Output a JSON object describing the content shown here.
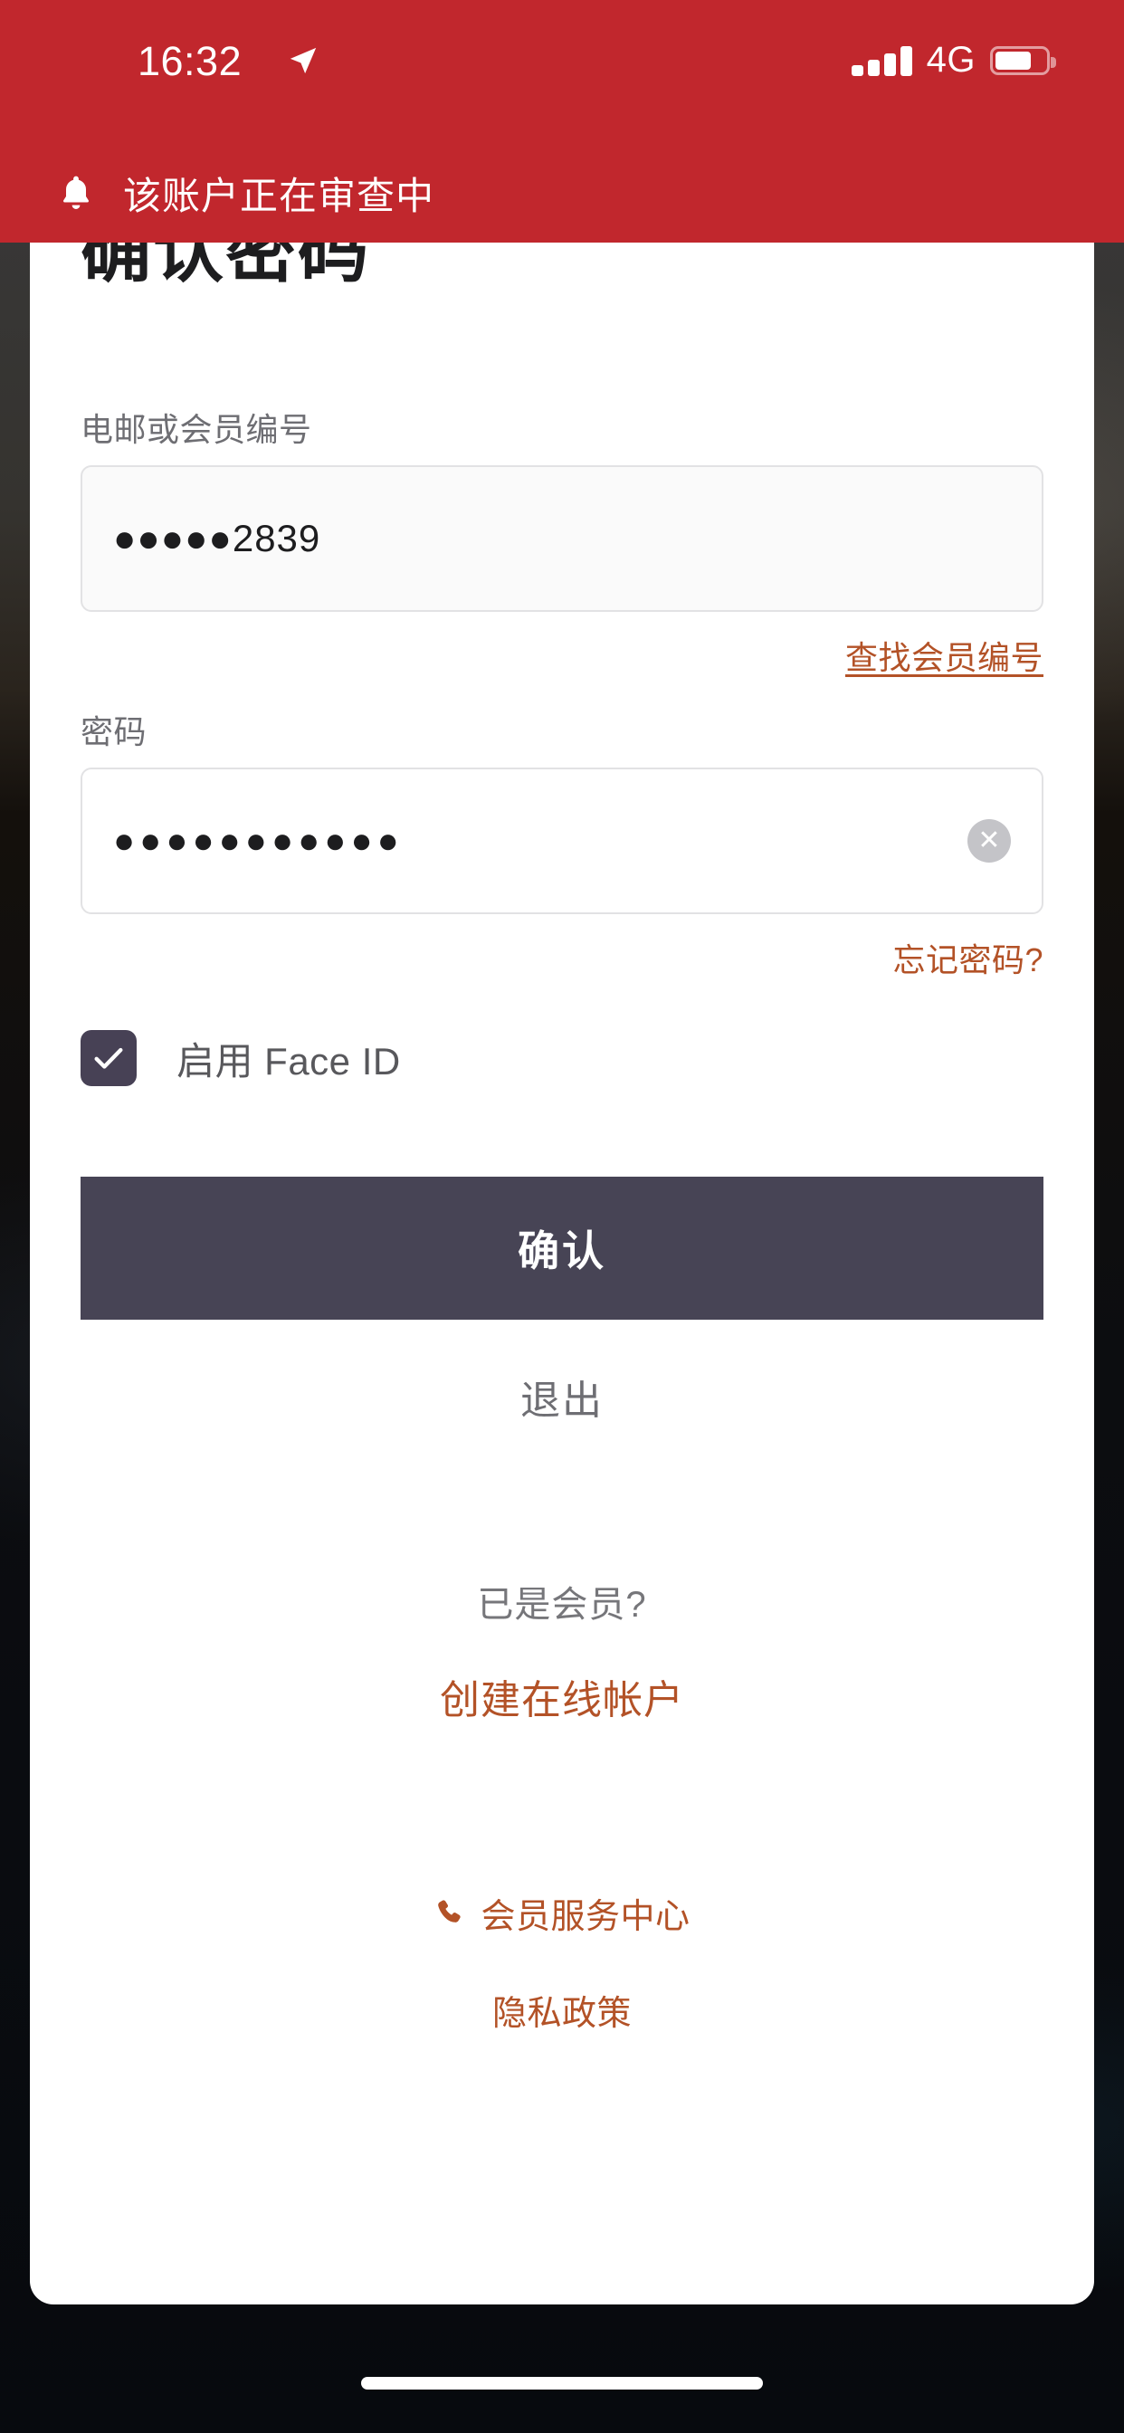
{
  "status_bar": {
    "time": "16:32",
    "location_icon": "location-arrow-icon",
    "signal_icon": "signal-bars-icon",
    "network": "4G",
    "battery_icon": "battery-icon",
    "battery_level_percent": 72,
    "background_color": "#c1272d",
    "text_color": "#ffffff"
  },
  "banner": {
    "icon": "bell-icon",
    "message": "该账户正在审查中",
    "background_color": "#c1272d",
    "text_color": "#ffffff"
  },
  "card": {
    "title": "确认密码",
    "member_field": {
      "label": "电邮或会员编号",
      "value": "●●●●●2839",
      "placeholder": "电邮或会员编号",
      "helper_link": "查找会员编号"
    },
    "password_field": {
      "label": "密码",
      "value": "●●●●●●●●●●●",
      "placeholder": "密码",
      "clear_icon": "close-circle-icon",
      "helper_link": "忘记密码?"
    },
    "face_id": {
      "label": "启用 Face ID",
      "checked": true,
      "check_icon": "checkmark-icon",
      "box_color": "#474155"
    },
    "confirm_button": {
      "label": "确认",
      "background_color": "#474455",
      "text_color": "#ffffff"
    },
    "logout_button": {
      "label": "退出",
      "text_color": "#6e6e73"
    },
    "signup": {
      "prompt": "已是会员?",
      "link": "创建在线帐户"
    },
    "footer": {
      "phone_icon": "phone-icon",
      "service_link": "会员服务中心",
      "privacy_link": "隐私政策"
    },
    "accent_color": "#b35227",
    "background_color": "#ffffff"
  },
  "system": {
    "home_indicator": "home-indicator"
  }
}
